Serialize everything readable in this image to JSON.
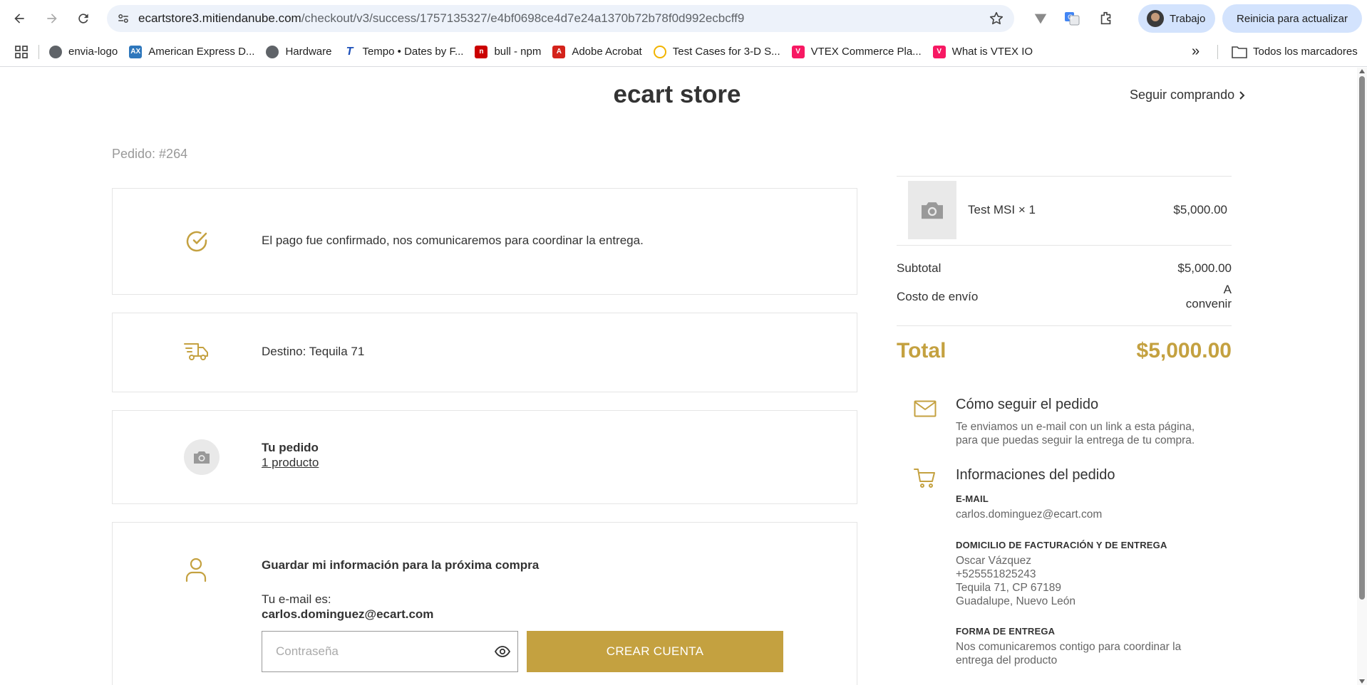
{
  "browser": {
    "url_host": "ecartstore3.mitiendanube.com",
    "url_path": "/checkout/v3/success/1757135327/e4bf0698ce4d7e24a1370b72b78f0d992ecbcff9",
    "profile_label": "Trabajo",
    "update_label": "Reinicia para actualizar",
    "bookmarks": [
      {
        "label": "envia-logo"
      },
      {
        "label": "American Express D..."
      },
      {
        "label": "Hardware"
      },
      {
        "label": "Tempo • Dates by F..."
      },
      {
        "label": "bull - npm"
      },
      {
        "label": "Adobe Acrobat"
      },
      {
        "label": "Test Cases for 3-D S..."
      },
      {
        "label": "VTEX Commerce Pla..."
      },
      {
        "label": "What is VTEX IO"
      }
    ],
    "all_bookmarks_label": "Todos los marcadores",
    "more_label": "»"
  },
  "header": {
    "store_name": "ecart store",
    "keep_shopping": "Seguir comprando",
    "order_number": "Pedido: #264"
  },
  "cards": {
    "payment_message": "El pago fue confirmado, nos comunicaremos para coordinar la entrega.",
    "destination": "Destino: Tequila 71",
    "order_title": "Tu pedido",
    "order_link": "1 producto",
    "save_title": "Guardar mi información para la próxima compra",
    "email_intro": "Tu e-mail es:",
    "email_value": "carlos.dominguez@ecart.com",
    "password_placeholder": "Contraseña",
    "create_account": "CREAR CUENTA"
  },
  "summary": {
    "product_name": "Test MSI × 1",
    "product_price": "$5,000.00",
    "subtotal_label": "Subtotal",
    "subtotal_value": "$5,000.00",
    "shipping_label": "Costo de envío",
    "shipping_value_1": "A",
    "shipping_value_2": "convenir",
    "total_label": "Total",
    "total_value": "$5,000.00"
  },
  "info": {
    "follow_title": "Cómo seguir el pedido",
    "follow_text_1": "Te enviamos un e-mail con un link a esta página,",
    "follow_text_2": "para que puedas seguir la entrega de tu compra.",
    "order_info_title": "Informaciones del pedido",
    "email_label": "E-MAIL",
    "email_value": "carlos.dominguez@ecart.com",
    "address_label": "DOMICILIO DE FACTURACIÓN Y DE ENTREGA",
    "address_name": "Oscar Vázquez",
    "address_phone": "+525551825243",
    "address_street": "Tequila 71, CP 67189",
    "address_city": "Guadalupe, Nuevo León",
    "delivery_label": "FORMA DE ENTREGA",
    "delivery_text_1": "Nos comunicaremos contigo para coordinar la",
    "delivery_text_2": "entrega del producto"
  },
  "colors": {
    "accent": "#c4a140",
    "chip": "#d3e3fd",
    "omnibox": "#edf2fa"
  }
}
